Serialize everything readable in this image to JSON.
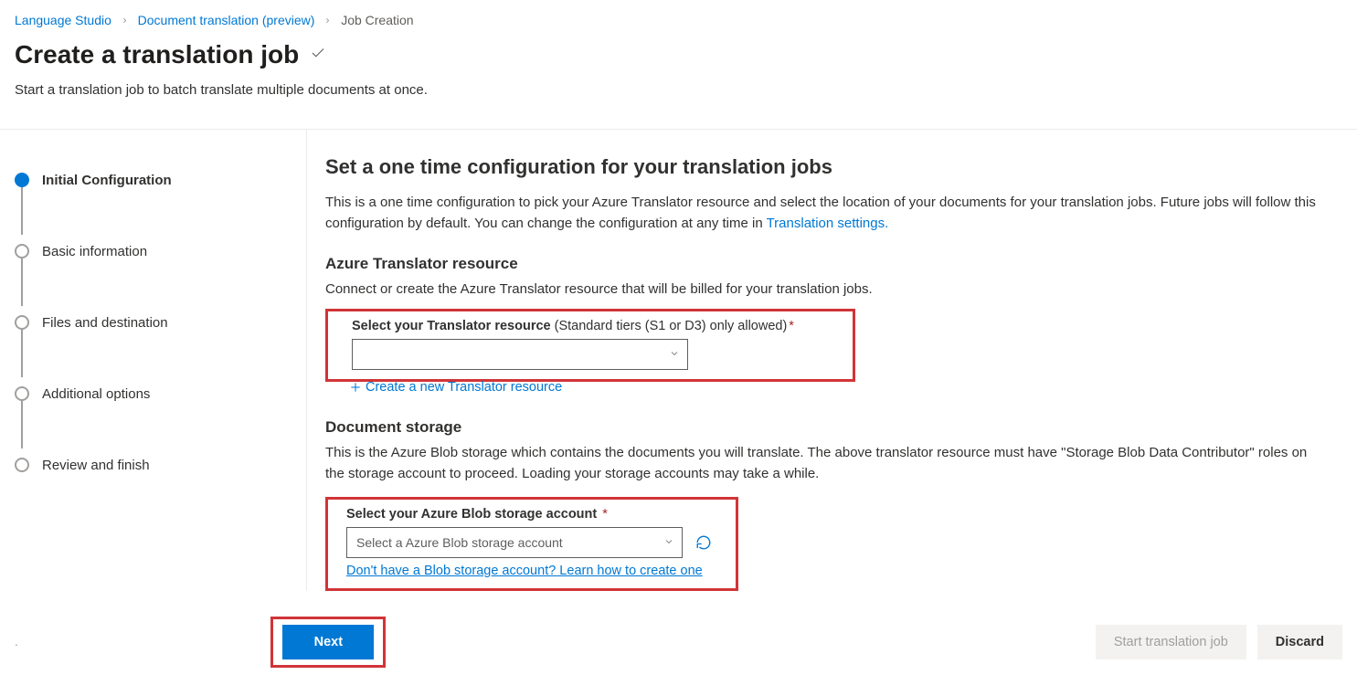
{
  "breadcrumb": {
    "items": [
      {
        "label": "Language Studio",
        "link": true
      },
      {
        "label": "Document translation (preview)",
        "link": true
      },
      {
        "label": "Job Creation",
        "link": false
      }
    ]
  },
  "header": {
    "title": "Create a translation job",
    "subtitle": "Start a translation job to batch translate multiple documents at once."
  },
  "stepper": {
    "steps": [
      {
        "label": "Initial Configuration",
        "active": true
      },
      {
        "label": "Basic information",
        "active": false
      },
      {
        "label": "Files and destination",
        "active": false
      },
      {
        "label": "Additional options",
        "active": false
      },
      {
        "label": "Review and finish",
        "active": false
      }
    ]
  },
  "main": {
    "title": "Set a one time configuration for your translation jobs",
    "desc_part1": "This is a one time configuration to pick your Azure Translator resource and select the location of your documents for your translation jobs. Future jobs will follow this configuration by default. You can change the configuration at any time in ",
    "desc_link": "Translation settings.",
    "translator": {
      "heading": "Azure Translator resource",
      "sub": "Connect or create the Azure Translator resource that will be billed for your translation jobs.",
      "field_label_bold": "Select your Translator resource",
      "field_label_rest": " (Standard tiers (S1 or D3) only allowed)",
      "create_link": "Create a new Translator resource"
    },
    "storage": {
      "heading": "Document storage",
      "sub": "This is the Azure Blob storage which contains the documents you will translate. The above translator resource must have \"Storage Blob Data Contributor\" roles on the storage account to proceed. Loading your storage accounts may take a while.",
      "field_label_bold": "Select your Azure Blob storage account",
      "select_placeholder": "Select a Azure Blob storage account",
      "learn_link": "Don't have a Blob storage account? Learn how to create one"
    }
  },
  "footer": {
    "next": "Next",
    "start": "Start translation job",
    "discard": "Discard"
  }
}
